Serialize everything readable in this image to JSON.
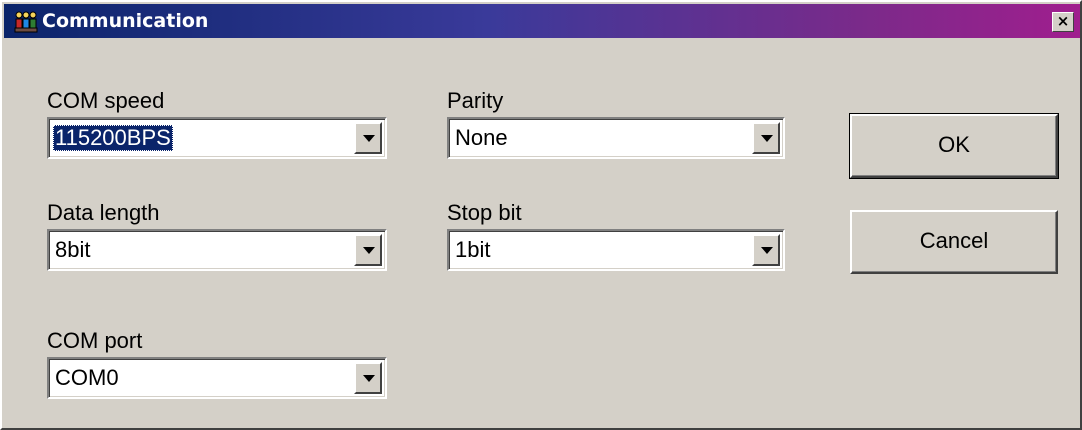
{
  "window": {
    "title": "Communication",
    "close_label": "×",
    "icon": "app-figures-icon"
  },
  "fields": {
    "com_speed": {
      "label": "COM speed",
      "value": "115200BPS"
    },
    "parity": {
      "label": "Parity",
      "value": "None"
    },
    "data_length": {
      "label": "Data length",
      "value": "8bit"
    },
    "stop_bit": {
      "label": "Stop bit",
      "value": "1bit"
    },
    "com_port": {
      "label": "COM port",
      "value": "COM0"
    }
  },
  "buttons": {
    "ok": "OK",
    "cancel": "Cancel"
  },
  "colors": {
    "title_gradient_start": "#0a246a",
    "title_gradient_end": "#a01e8e",
    "face": "#d4d0c8",
    "selection": "#0a246a"
  }
}
